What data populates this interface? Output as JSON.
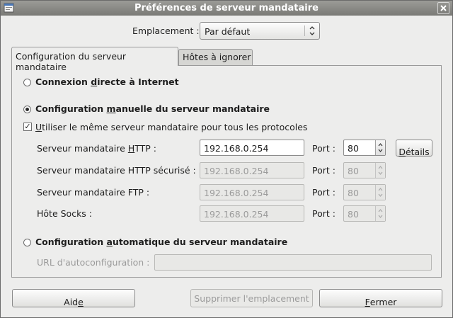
{
  "window": {
    "title": "Préférences de serveur mandataire"
  },
  "location": {
    "label": "Emplacement :",
    "selected": "Par défaut"
  },
  "tabs": [
    {
      "label": "Configuration du serveur mandataire"
    },
    {
      "label": "Hôtes à ignorer"
    }
  ],
  "direct": {
    "pre": "Connexion ",
    "ul": "d",
    "post": "irecte à Internet"
  },
  "manual": {
    "pre": "Configuration ",
    "ul": "m",
    "post": "anuelle du serveur mandataire"
  },
  "same_proxy": {
    "ul": "U",
    "post": "tiliser le même serveur mandataire pour tous les protocoles",
    "checked": true
  },
  "http": {
    "label_pre": "Serveur mandataire ",
    "label_ul": "H",
    "label_post": "TTP :",
    "host": "192.168.0.254",
    "port_label": "Port :",
    "port": "80"
  },
  "details": {
    "ul": "D",
    "post": "étails"
  },
  "https": {
    "label": "Serveur mandataire HTTP sécurisé :",
    "host": "192.168.0.254",
    "port_label": "Port :",
    "port": "80"
  },
  "ftp": {
    "label": "Serveur mandataire FTP :",
    "host": "192.168.0.254",
    "port_label": "Port :",
    "port": "80"
  },
  "socks": {
    "label": "Hôte Socks :",
    "host": "192.168.0.254",
    "port_label": "Port :",
    "port": "80"
  },
  "auto": {
    "pre": "Configuration ",
    "ul": "a",
    "post": "utomatique du serveur mandataire",
    "url_label": "URL d'autoconfiguration :",
    "url_value": ""
  },
  "buttons": {
    "help": {
      "pre": "Aid",
      "ul": "e",
      "post": ""
    },
    "delete": {
      "label": "Supprimer l'emplacement"
    },
    "close": {
      "ul": "F",
      "post": "ermer"
    }
  }
}
